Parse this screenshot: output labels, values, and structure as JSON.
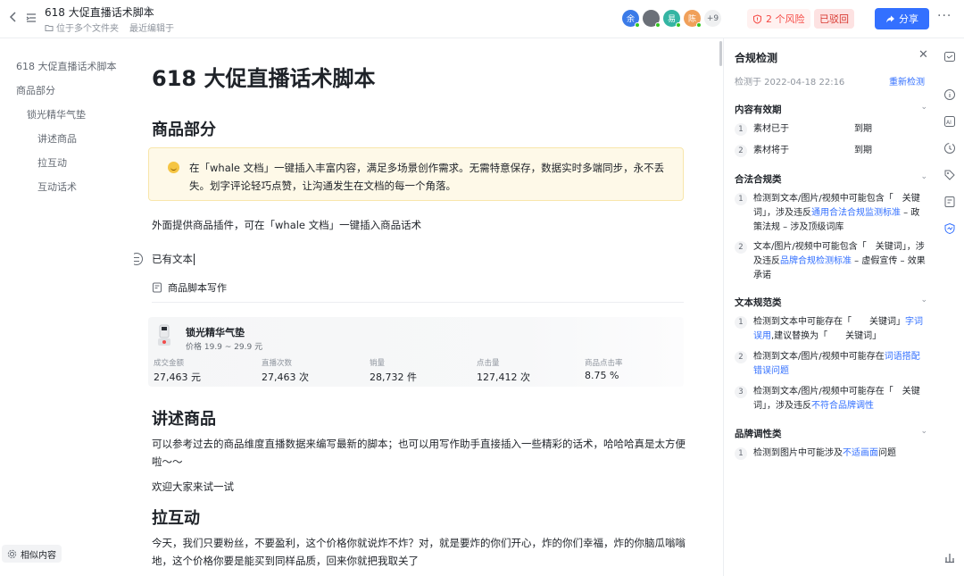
{
  "topbar": {
    "title": "618 大促直播话术脚本",
    "folder": "位于多个文件夹",
    "edited": "最近编辑于",
    "avatars": [
      {
        "initial": "余",
        "color": "#3b7be8"
      },
      {
        "initial": "",
        "color": "#6b7078"
      },
      {
        "initial": "易",
        "color": "#34b5a3"
      },
      {
        "initial": "陈",
        "color": "#f0a05a"
      }
    ],
    "more_count": "+9",
    "risk_label": "2 个风险",
    "rejected_label": "已驳回",
    "share_label": "分享"
  },
  "toc": {
    "items": [
      "618 大促直播话术脚本",
      "商品部分",
      "锁光精华气垫",
      "讲述商品",
      "拉互动",
      "互动话术"
    ]
  },
  "similar_label": "相似内容",
  "doc": {
    "title": "618 大促直播话术脚本",
    "section1": "商品部分",
    "callout": "在「whale 文档」一键插入丰富内容，满足多场景创作需求。无需特意保存，数据实时多端同步，永不丢失。划字评论轻巧点赞，让沟通发生在文档的每一个角落。",
    "para1": "外面提供商品插件，可在「whale 文档」一键插入商品话术",
    "existing_text": "已有文本",
    "script_title": "商品脚本写作",
    "product": {
      "name": "锁光精华气垫",
      "price": "价格 19.9 ~ 29.9 元",
      "stats": [
        {
          "label": "成交金额",
          "value": "27,463 元"
        },
        {
          "label": "直播次数",
          "value": "27,463 次"
        },
        {
          "label": "销量",
          "value": "28,732 件"
        },
        {
          "label": "点击量",
          "value": "127,412 次"
        },
        {
          "label": "商品点击率",
          "value": "8.75 %"
        }
      ]
    },
    "section2": "讲述商品",
    "para2": "可以参考过去的商品维度直播数据来编写最新的脚本；也可以用写作助手直接插入一些精彩的话术，哈哈哈真是太方便啦～～",
    "para3": "欢迎大家来试一试",
    "section3": "拉互动",
    "para4": "今天，我们只要粉丝，不要盈利，这个价格你就说炸不炸？对，就是要炸的你们开心，炸的你们幸福，炸的你脑瓜嗡嗡地，这个价格你要是能买到同样品质，回来你就把我取关了"
  },
  "panel": {
    "title": "合规检测",
    "time": "检测于 2022-04-18 22:16",
    "recheck": "重新检测",
    "sections": [
      {
        "title": "内容有效期"
      },
      {
        "title": "合法合规类"
      },
      {
        "title": "文本规范类"
      },
      {
        "title": "品牌调性类"
      }
    ],
    "validity": [
      {
        "num": "1",
        "text": "素材已于",
        "right": "到期"
      },
      {
        "num": "2",
        "text": "素材将于",
        "right": "到期"
      }
    ],
    "legal": [
      {
        "num": "1",
        "pre": "检测到文本/图片/视频中可能包含「　关键词」，涉及违反",
        "link": "通用合法合规监测标准",
        "post": " – 政策法规 – 涉及顶级词库"
      },
      {
        "num": "2",
        "pre": "文本/图片/视频中可能包含「　关键词」，涉及违反",
        "link": "品牌合规检测标准",
        "post": " – 虚假宣传 – 效果承诺"
      }
    ],
    "text_norm": [
      {
        "num": "1",
        "pre": "检测到文本中可能存在「　　关键词」",
        "link": "字词误用",
        "post": ",建议替换为「　　关键词」"
      },
      {
        "num": "2",
        "pre": "检测到文本/图片/视频中可能存在",
        "link": "词语搭配错误问题",
        "post": ""
      },
      {
        "num": "3",
        "pre": "检测到文本/图片/视频中可能存在「　关键词」，涉及违反",
        "link": "不符合品牌调性",
        "post": ""
      }
    ],
    "brand": [
      {
        "num": "1",
        "pre": "检测到图片中可能涉及",
        "link": "不适画面",
        "post": "问题"
      }
    ]
  },
  "rail": {
    "icons": [
      "comment-icon",
      "info-icon",
      "ai-icon",
      "history-icon",
      "tag-icon",
      "form-icon",
      "compliance-icon",
      "stats-icon"
    ]
  }
}
